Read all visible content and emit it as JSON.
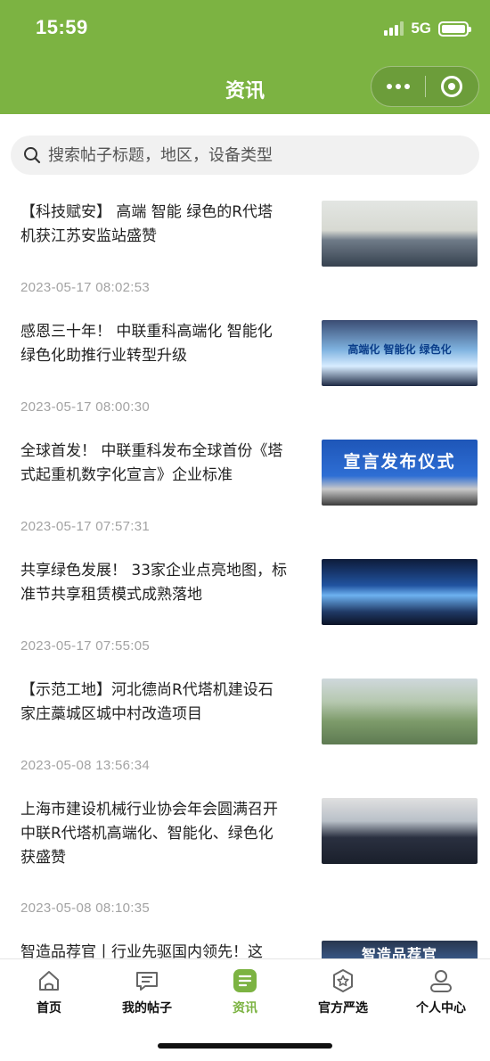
{
  "status_bar": {
    "time": "15:59",
    "network": "5G"
  },
  "header": {
    "title": "资讯"
  },
  "search": {
    "placeholder": "搜索帖子标题，地区，设备类型"
  },
  "articles": [
    {
      "title": "【科技赋安】 高端 智能 绿色的R代塔机获江苏安监站盛赞",
      "time": "2023-05-17 08:02:53"
    },
    {
      "title": "感恩三十年！ 中联重科高端化 智能化 绿色化助推行业转型升级",
      "time": "2023-05-17 08:00:30",
      "thumb_text": "高端化 智能化 绿色化"
    },
    {
      "title": "全球首发！ 中联重科发布全球首份《塔式起重机数字化宣言》企业标准",
      "time": "2023-05-17 07:57:31",
      "thumb_text": "宣言发布仪式"
    },
    {
      "title": "共享绿色发展！ 33家企业点亮地图，标准节共享租赁模式成熟落地",
      "time": "2023-05-17 07:55:05"
    },
    {
      "title": "【示范工地】河北德尚R代塔机建设石家庄藁城区城中村改造项目",
      "time": "2023-05-08 13:56:34"
    },
    {
      "title": "上海市建设机械行业协会年会圆满召开 中联R代塔机高端化、智能化、绿色化获盛赞",
      "time": "2023-05-08 08:10:35"
    },
    {
      "title": "智造品荐官丨行业先驱国内领先！这",
      "time": "",
      "thumb_text": "智造品荐官"
    }
  ],
  "tabbar": {
    "items": [
      {
        "label": "首页",
        "icon": "home-icon"
      },
      {
        "label": "我的帖子",
        "icon": "message-icon"
      },
      {
        "label": "资讯",
        "icon": "news-icon"
      },
      {
        "label": "官方严选",
        "icon": "star-badge-icon"
      },
      {
        "label": "个人中心",
        "icon": "user-icon"
      }
    ],
    "active": "资讯"
  },
  "colors": {
    "primary": "#7cb342",
    "text": "#222222",
    "muted": "#a3a3a3"
  }
}
